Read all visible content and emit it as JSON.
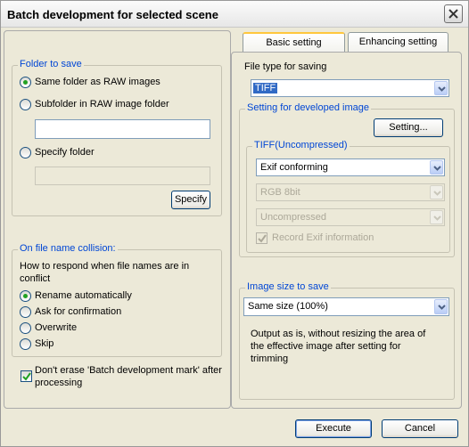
{
  "window": {
    "title": "Batch development for selected scene"
  },
  "tabs": [
    {
      "label": "Basic setting"
    },
    {
      "label": "Enhancing setting"
    }
  ],
  "folder": {
    "group_label": "Folder to save",
    "options": [
      {
        "label": "Same folder as RAW images",
        "checked": true
      },
      {
        "label": "Subfolder in RAW image folder",
        "checked": false
      },
      {
        "label": "Specify folder",
        "checked": false
      }
    ],
    "subfolder_value": "",
    "specify_value": "",
    "specify_button": "Specify"
  },
  "collision": {
    "group_label": "On file name collision:",
    "description_line1": "How to respond when file names are in",
    "description_line2": "conflict",
    "options": [
      {
        "label": "Rename automatically",
        "checked": true
      },
      {
        "label": "Ask for confirmation",
        "checked": false
      },
      {
        "label": "Overwrite",
        "checked": false
      },
      {
        "label": "Skip",
        "checked": false
      }
    ]
  },
  "dont_erase": {
    "label_line1": "Don't erase 'Batch development mark' after",
    "label_line2": "processing",
    "checked": true
  },
  "file_type": {
    "label": "File type for saving",
    "value": "TIFF"
  },
  "developed": {
    "group_label": "Setting for developed image",
    "setting_button": "Setting...",
    "tiff_group_label": "TIFF(Uncompressed)",
    "exif_value": "Exif conforming",
    "color_value": "RGB 8bit",
    "compression_value": "Uncompressed",
    "record_exif_label": "Record Exif information",
    "record_exif_checked": true
  },
  "image_size": {
    "group_label": "Image size to save",
    "value": "Same size (100%)",
    "description_line1": "Output as is, without resizing the area of",
    "description_line2": "the effective image after setting for",
    "description_line3": "trimming"
  },
  "buttons": {
    "execute": "Execute",
    "cancel": "Cancel"
  },
  "colors": {
    "group_label": "#0046d5",
    "dialog_bg": "#ece9d8",
    "tab_highlight": "#ffc73c",
    "selection": "#316ac5"
  },
  "icons": [
    "close-icon",
    "checkmark-icon",
    "dropdown-arrow-icon"
  ]
}
